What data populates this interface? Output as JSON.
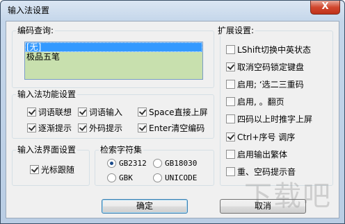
{
  "window": {
    "title": "输入法设置",
    "close_label": "X"
  },
  "code_query": {
    "label": "编码查询:",
    "items": [
      {
        "label": "[无]",
        "selected": true
      },
      {
        "label": "极品五笔",
        "selected": false
      }
    ]
  },
  "ime_functions": {
    "label": "输入法功能设置",
    "options": [
      {
        "label": "词语联想",
        "checked": true
      },
      {
        "label": "词语输入",
        "checked": true
      },
      {
        "label": "Space直接上屏",
        "checked": true
      },
      {
        "label": "逐渐提示",
        "checked": true
      },
      {
        "label": "外码提示",
        "checked": true
      },
      {
        "label": "Enter清空编码",
        "checked": true
      }
    ]
  },
  "ime_interface": {
    "label": "输入法界面设置",
    "cursor_follow": {
      "label": "光标跟随",
      "checked": true
    }
  },
  "charset": {
    "label": "检索字符集",
    "options": [
      {
        "label": "GB2312",
        "checked": true
      },
      {
        "label": "GB18030",
        "checked": false
      },
      {
        "label": "GBK",
        "checked": false
      },
      {
        "label": "UNICODE",
        "checked": false
      }
    ]
  },
  "extended": {
    "label": "扩展设置:",
    "options": [
      {
        "label": "LShift切换中英状态",
        "checked": false
      },
      {
        "label": "取消空码锁定键盘",
        "checked": true
      },
      {
        "label": "启用; ‘选二三重码",
        "checked": false
      },
      {
        "label": "启用, 。翻页",
        "checked": false
      },
      {
        "label": "四码以上时推字上屏",
        "checked": false
      },
      {
        "label": "Ctrl+序号 调序",
        "checked": true
      },
      {
        "label": "启用输出繁体",
        "checked": false
      },
      {
        "label": "重、空码提示音",
        "checked": false
      }
    ]
  },
  "buttons": {
    "ok": "确定",
    "cancel": "取消"
  },
  "watermark": "下载吧"
}
